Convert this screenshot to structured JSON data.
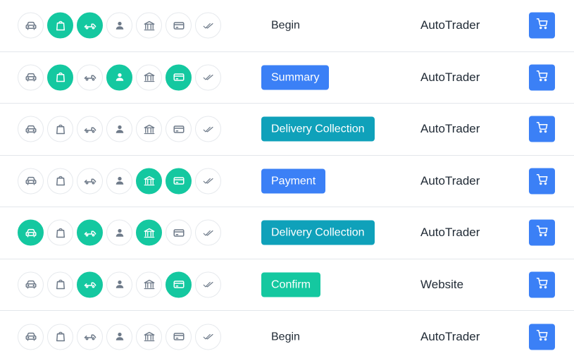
{
  "colors": {
    "active_step": "#14c8a0",
    "badge_blue": "#3b80f6",
    "badge_teal": "#0fa1ba",
    "badge_green": "#14c8a0",
    "cart_button": "#3b80f6"
  },
  "step_icons": [
    "car-icon",
    "shopping-bag-icon",
    "truck-icon",
    "person-icon",
    "bank-icon",
    "credit-card-icon",
    "double-check-icon"
  ],
  "rows": [
    {
      "stage": "Begin",
      "stage_style": "plain",
      "source": "AutoTrader",
      "active_steps": [
        false,
        true,
        true,
        false,
        false,
        false,
        false
      ]
    },
    {
      "stage": "Summary",
      "stage_style": "blue",
      "source": "AutoTrader",
      "active_steps": [
        false,
        true,
        false,
        true,
        false,
        true,
        false
      ]
    },
    {
      "stage": "Delivery Collection",
      "stage_style": "teal",
      "source": "AutoTrader",
      "active_steps": [
        false,
        false,
        false,
        false,
        false,
        false,
        false
      ]
    },
    {
      "stage": "Payment",
      "stage_style": "blue",
      "source": "AutoTrader",
      "active_steps": [
        false,
        false,
        false,
        false,
        true,
        true,
        false
      ]
    },
    {
      "stage": "Delivery Collection",
      "stage_style": "teal",
      "source": "AutoTrader",
      "active_steps": [
        true,
        false,
        true,
        false,
        true,
        false,
        false
      ]
    },
    {
      "stage": "Confirm",
      "stage_style": "green",
      "source": "Website",
      "active_steps": [
        false,
        false,
        true,
        false,
        false,
        true,
        false
      ]
    },
    {
      "stage": "Begin",
      "stage_style": "plain",
      "source": "AutoTrader",
      "active_steps": [
        false,
        false,
        false,
        false,
        false,
        false,
        false
      ]
    }
  ]
}
